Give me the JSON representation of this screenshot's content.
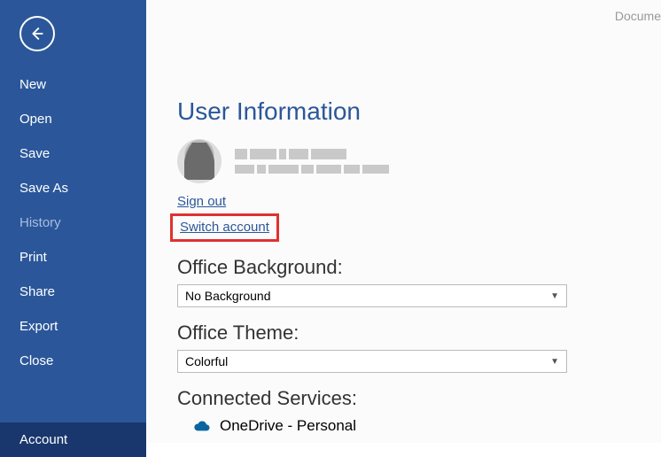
{
  "header": {
    "doc_label": "Docume"
  },
  "sidebar": {
    "items": [
      {
        "label": "New"
      },
      {
        "label": "Open"
      },
      {
        "label": "Save"
      },
      {
        "label": "Save As"
      },
      {
        "label": "History"
      },
      {
        "label": "Print"
      },
      {
        "label": "Share"
      },
      {
        "label": "Export"
      },
      {
        "label": "Close"
      },
      {
        "label": "Account"
      }
    ]
  },
  "main": {
    "title": "User Information",
    "sign_out": "Sign out",
    "switch_account": "Switch account",
    "bg_label": "Office Background:",
    "bg_value": "No Background",
    "theme_label": "Office Theme:",
    "theme_value": "Colorful",
    "services_label": "Connected Services:",
    "service_0": "OneDrive - Personal"
  }
}
